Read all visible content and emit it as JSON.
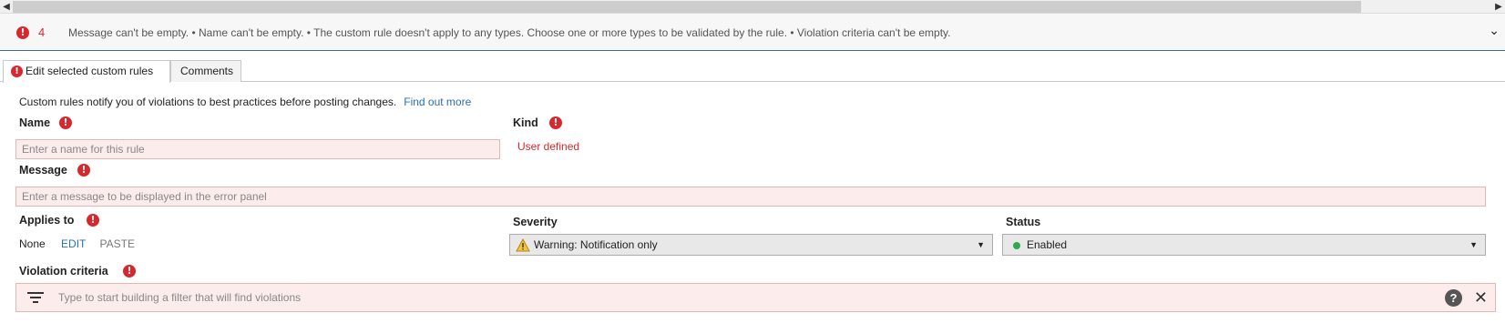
{
  "validation": {
    "count": "4",
    "messages": "Message can't be empty.  • Name can't be empty.  • The custom rule doesn't apply to any types. Choose one or more types to be validated by the rule.  • Violation criteria can't be empty."
  },
  "tabs": [
    {
      "label": "Edit selected custom rules"
    },
    {
      "label": "Comments"
    }
  ],
  "intro": {
    "text": "Custom rules notify you of violations to best practices before posting changes.",
    "link": "Find out more"
  },
  "name": {
    "label": "Name",
    "placeholder": "Enter a name for this rule"
  },
  "kind": {
    "label": "Kind",
    "value": "User defined"
  },
  "message": {
    "label": "Message",
    "placeholder": "Enter a message to be displayed in the error panel"
  },
  "applies_to": {
    "label": "Applies to",
    "value": "None",
    "edit": "EDIT",
    "paste": "PASTE"
  },
  "severity": {
    "label": "Severity",
    "value": "Warning: Notification only"
  },
  "status": {
    "label": "Status",
    "value": "Enabled"
  },
  "violation": {
    "label": "Violation criteria",
    "placeholder": "Type to start building a filter that will find violations"
  },
  "colors": {
    "error": "#d9272e",
    "link": "#2a6ebb",
    "invalid_bg": "#fdecec",
    "enabled": "#2fa84f"
  }
}
